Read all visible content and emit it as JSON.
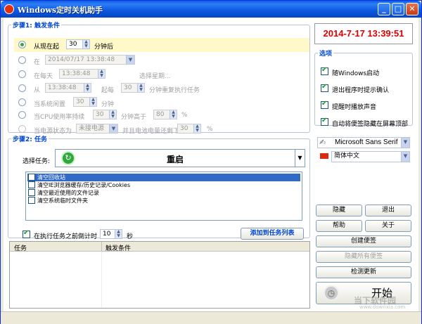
{
  "window": {
    "title": "Windows定时关机助手",
    "min": "_",
    "max": "□",
    "close": "✕"
  },
  "step1": {
    "legend": "步骤1: 触发条件",
    "r0": {
      "label": "从现在起",
      "value": "30",
      "suffix": "分钟后"
    },
    "r1": {
      "label": "在",
      "value": "2014/07/17  13:38:48"
    },
    "r2": {
      "label": "在每天",
      "value": "13:38:48",
      "suffix": "选择星期..."
    },
    "r3": {
      "label": "从",
      "value": "13:38:48",
      "mid": "起每",
      "value2": "30",
      "suffix": "分钟重复执行任务"
    },
    "r4": {
      "label": "当系统闲置",
      "value": "30",
      "suffix": "分钟"
    },
    "r5": {
      "label": "当CPU使用率持续",
      "value": "30",
      "mid": "分钟高于",
      "value2": "80",
      "suffix": "%"
    },
    "r6": {
      "label": "当电源状态为",
      "value": "未接电源",
      "mid": "并且电池电量还剩下",
      "value2": "30",
      "suffix": "%"
    }
  },
  "clock": {
    "text": "2014-7-17 13:39:51",
    "color": "#e00000"
  },
  "options": {
    "legend": "选项",
    "items": [
      "随Windows启动",
      "退出程序时提示确认",
      "提醒时播放声音",
      "自动将便签隐藏在屏幕顶部"
    ]
  },
  "font_select": "Microsoft Sans Serif",
  "lang_select": "简体中文",
  "step2": {
    "legend": "步骤2: 任务",
    "task_label": "选择任务:",
    "task_value": "重启",
    "subtasks": [
      "清空回收站",
      "清空IE浏览器缓存/历史记录/Cookies",
      "清空最近使用的文件记录",
      "清空系统临时文件夹"
    ],
    "countdown_label": "在执行任务之前倒计时",
    "countdown_value": "10",
    "countdown_unit": "秒",
    "add_button": "添加到任务列表"
  },
  "table": {
    "headers": [
      "任务",
      "触发条件"
    ]
  },
  "buttons": {
    "hide": "隐藏",
    "exit": "退出",
    "help": "帮助",
    "about": "关于",
    "create_note": "创建便签",
    "hide_notes": "隐藏所有便签",
    "check_update": "检测更新",
    "start": "开始"
  },
  "watermark": {
    "main": "当下软件园",
    "sub": "www.downxia.com"
  }
}
